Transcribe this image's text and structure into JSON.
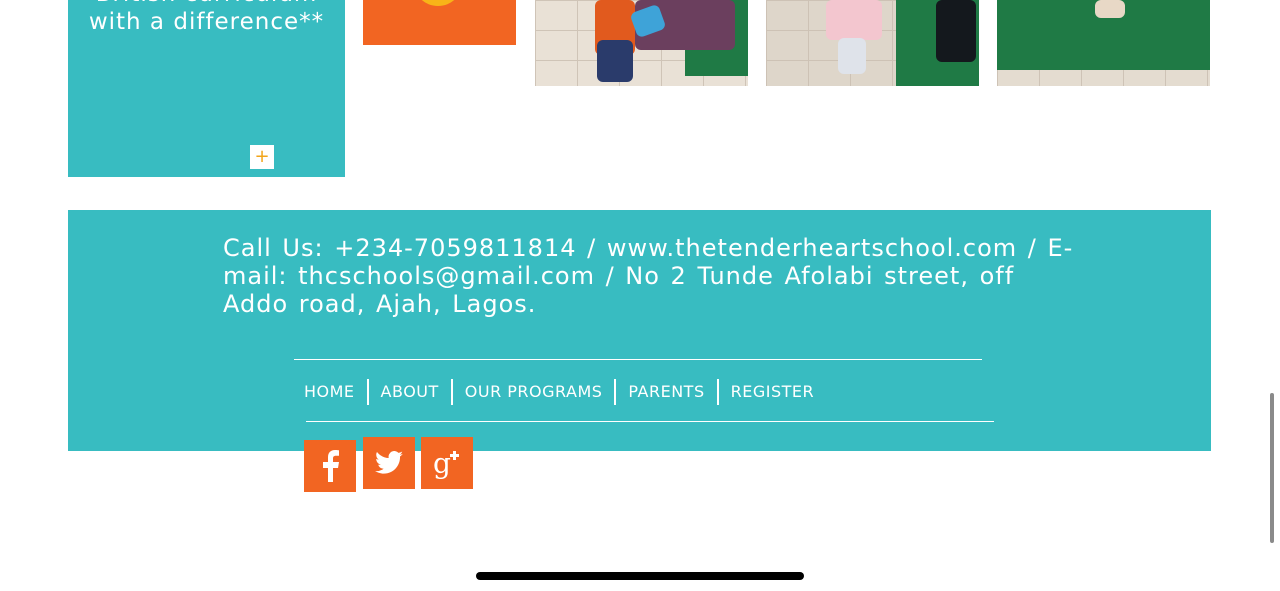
{
  "promo": {
    "text": "British curriculum with a difference**",
    "more_icon": "+"
  },
  "footer": {
    "contact_text": "Call Us: +234-7059811814  /   www.thetenderheartschool.com   / E-mail: thcschools@gmail.com  / No 2 Tunde Afolabi street, off Addo road, Ajah, Lagos.",
    "nav": [
      {
        "label": "HOME"
      },
      {
        "label": "ABOUT"
      },
      {
        "label": "OUR PROGRAMS"
      },
      {
        "label": "PARENTS"
      },
      {
        "label": "REGISTER"
      }
    ],
    "social": [
      {
        "icon": "facebook-icon",
        "glyph": "f"
      },
      {
        "icon": "twitter-icon",
        "glyph": "bird"
      },
      {
        "icon": "google-plus-icon",
        "glyph": "g+"
      }
    ]
  },
  "colors": {
    "teal": "#38bcc1",
    "orange": "#f26522",
    "white": "#ffffff"
  }
}
